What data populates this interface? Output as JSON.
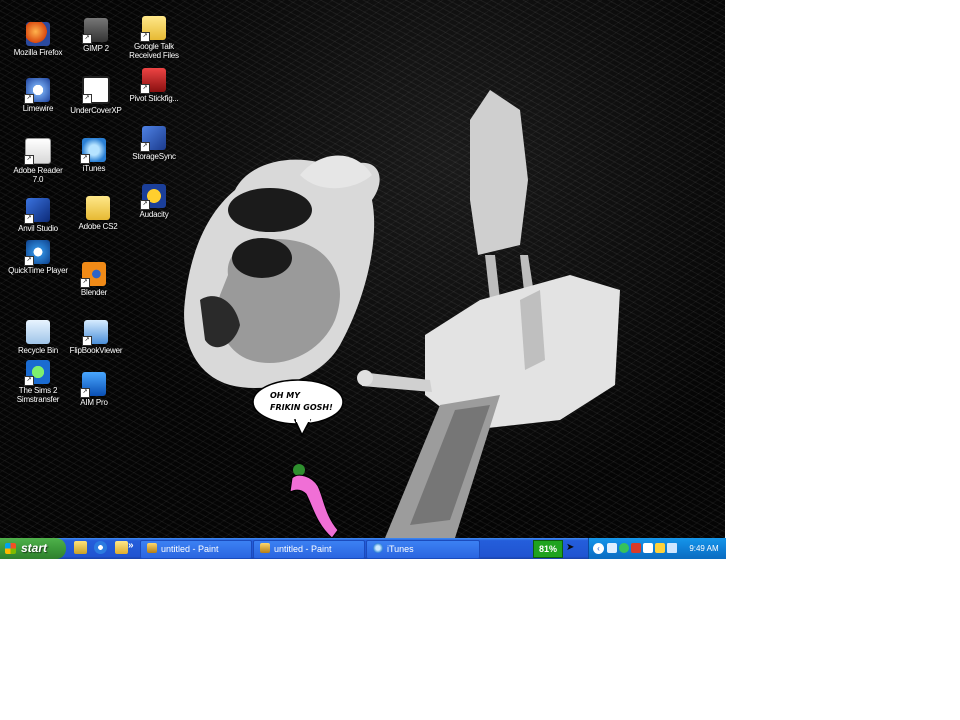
{
  "desktop": {
    "icons": [
      {
        "label": "Mozilla Firefox",
        "icon": "firefox-icon",
        "shortcut": false
      },
      {
        "label": "GIMP 2",
        "icon": "gimp-icon",
        "shortcut": true
      },
      {
        "label": "Google Talk Received Files",
        "icon": "folder-icon",
        "shortcut": true
      },
      {
        "label": "Limewire",
        "icon": "limewire-icon",
        "shortcut": true
      },
      {
        "label": "UnderCoverXP",
        "icon": "undercover-icon",
        "shortcut": true
      },
      {
        "label": "Pivot Stickfig...",
        "icon": "pivot-icon",
        "shortcut": true
      },
      {
        "label": "Adobe Reader 7.0",
        "icon": "adobe-reader-icon",
        "shortcut": true
      },
      {
        "label": "iTunes",
        "icon": "itunes-icon",
        "shortcut": true
      },
      {
        "label": "StorageSync",
        "icon": "storagesync-icon",
        "shortcut": true
      },
      {
        "label": "Anvil Studio",
        "icon": "anvil-icon",
        "shortcut": true
      },
      {
        "label": "Adobe CS2",
        "icon": "folder-icon",
        "shortcut": false
      },
      {
        "label": "Audacity",
        "icon": "audacity-icon",
        "shortcut": true
      },
      {
        "label": "QuickTime Player",
        "icon": "quicktime-icon",
        "shortcut": true
      },
      {
        "label": "Blender",
        "icon": "blender-icon",
        "shortcut": true
      },
      {
        "label": "Recycle Bin",
        "icon": "recycle-bin-icon",
        "shortcut": false
      },
      {
        "label": "FlipBookViewer",
        "icon": "flipbook-icon",
        "shortcut": true
      },
      {
        "label": "The Sims 2 Simstransfer",
        "icon": "sims-icon",
        "shortcut": true
      },
      {
        "label": "AIM Pro",
        "icon": "aim-icon",
        "shortcut": true
      }
    ],
    "speech_bubble": {
      "line1": "OH MY",
      "line2": "FRIKIN GOSH!"
    },
    "colors": {
      "satellite": "#d9d9d9",
      "satellite_shadow": "#8a8a8a",
      "figure_pink": "#f06fd6",
      "figure_head": "#2e8f2e"
    }
  },
  "taskbar": {
    "start_label": "start",
    "quicklaunch_more": "»",
    "tasks": [
      {
        "label": "untitled - Paint",
        "icon": "paint-icon"
      },
      {
        "label": "untitled - Paint",
        "icon": "paint-icon"
      },
      {
        "label": "iTunes",
        "icon": "itunes-icon"
      }
    ],
    "battery": "81%",
    "tray_chevron": "‹",
    "clock": "9:49 AM"
  }
}
